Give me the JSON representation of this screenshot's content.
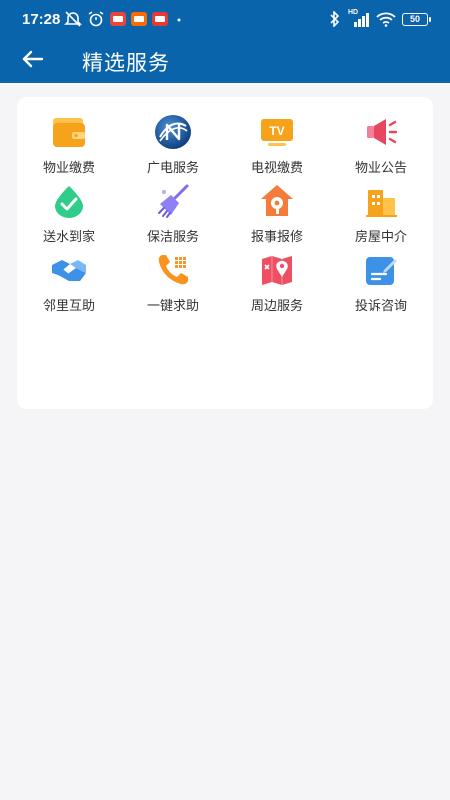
{
  "status_bar": {
    "time": "17:28",
    "signal_tag": "HD",
    "battery": "50"
  },
  "header": {
    "title": "精选服务"
  },
  "services": [
    {
      "label": "物业缴费",
      "icon": "wallet-icon"
    },
    {
      "label": "广电服务",
      "icon": "broadcast-logo-icon"
    },
    {
      "label": "电视缴费",
      "icon": "tv-icon"
    },
    {
      "label": "物业公告",
      "icon": "megaphone-icon"
    },
    {
      "label": "送水到家",
      "icon": "water-delivery-icon"
    },
    {
      "label": "保洁服务",
      "icon": "broom-icon"
    },
    {
      "label": "报事报修",
      "icon": "repair-house-icon"
    },
    {
      "label": "房屋中介",
      "icon": "building-icon"
    },
    {
      "label": "邻里互助",
      "icon": "handshake-icon"
    },
    {
      "label": "一键求助",
      "icon": "phone-icon"
    },
    {
      "label": "周边服务",
      "icon": "map-pin-icon"
    },
    {
      "label": "投诉咨询",
      "icon": "feedback-note-icon"
    }
  ],
  "colors": {
    "header_bg": "#0964ab",
    "page_bg": "#f5f5f7",
    "card_bg": "#ffffff"
  }
}
